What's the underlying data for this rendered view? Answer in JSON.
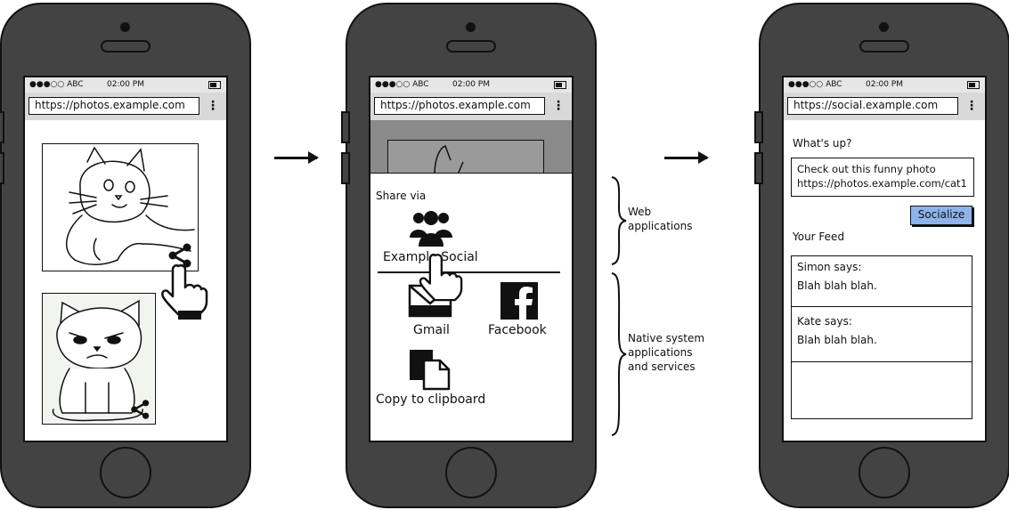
{
  "status_bar": {
    "signal": "●●●○○ ABC",
    "time": "02:00 PM"
  },
  "phone1": {
    "url": "https://photos.example.com"
  },
  "phone2": {
    "url": "https://photos.example.com",
    "share_title": "Share via",
    "targets": {
      "example_social": "Example Social",
      "gmail": "Gmail",
      "facebook": "Facebook",
      "clipboard": "Copy to clipboard"
    }
  },
  "annotations": {
    "web": [
      "Web",
      "applications"
    ],
    "native": [
      "Native system",
      "applications",
      "and services"
    ]
  },
  "phone3": {
    "url": "https://social.example.com",
    "whats_up": "What's up?",
    "post_lines": [
      "Check out this funny photo",
      "https://photos.example.com/cat1"
    ],
    "socialize_label": "Socialize",
    "feed_title": "Your Feed",
    "feed": [
      {
        "author": "Simon says:",
        "text": "Blah blah blah."
      },
      {
        "author": "Kate says:",
        "text": "Blah blah blah."
      }
    ]
  },
  "icons": [
    "share-icon",
    "pointing-hand-icon",
    "group-icon",
    "gmail-icon",
    "facebook-icon",
    "copy-icon",
    "cat-sketch"
  ],
  "colors": {
    "phone_body": "#434343",
    "statusbar": "#e6e6e6",
    "urlbar": "#d9d9d9",
    "socialize": "#8db3ea"
  }
}
